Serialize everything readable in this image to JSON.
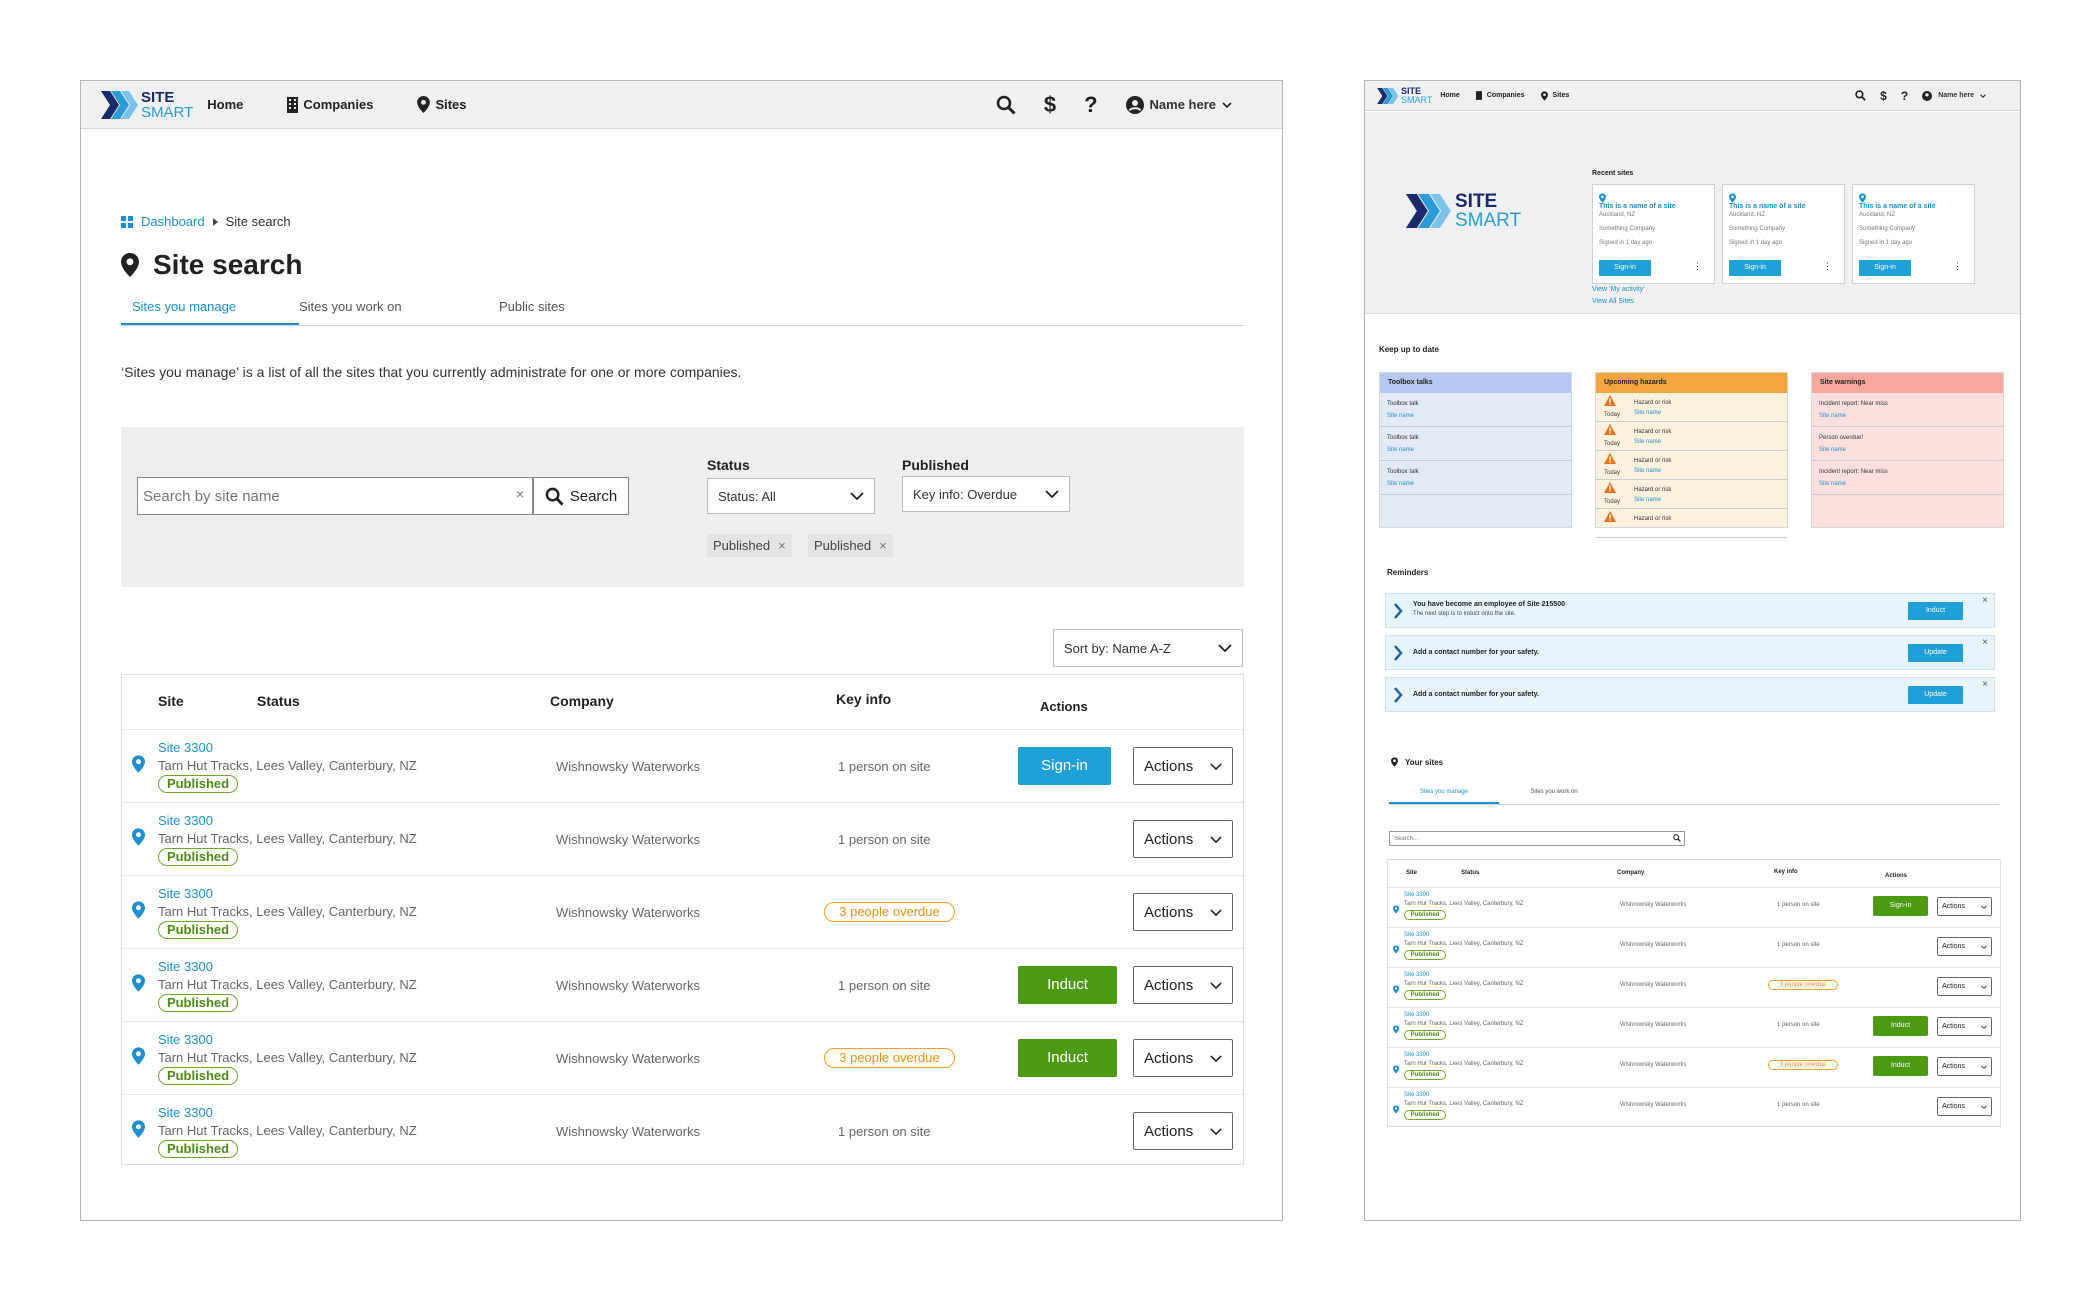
{
  "brand": {
    "line1": "SITE",
    "line2": "SMART"
  },
  "nav": {
    "home": "Home",
    "companies": "Companies",
    "sites": "Sites"
  },
  "header": {
    "user_name": "Name here"
  },
  "breadcrumb": {
    "dashboard": "Dashboard",
    "current": "Site search"
  },
  "page": {
    "title": "Site search",
    "tabs": [
      "Sites you manage",
      "Sites you work on",
      "Public sites"
    ],
    "description": "‘Sites you manage’ is a list of all the sites that you currently administrate for one or more companies."
  },
  "filters": {
    "search_placeholder": "Search by site name",
    "search_button": "Search",
    "status_label": "Status",
    "status_value": "Status: All",
    "published_label": "Published",
    "published_value": "Key info: Overdue",
    "chips": [
      "Published",
      "Published"
    ],
    "sort_value": "Sort by: Name A-Z"
  },
  "table": {
    "headers": {
      "site": "Site",
      "status": "Status",
      "company": "Company",
      "key_info": "Key info",
      "actions": "Actions"
    },
    "rows": [
      {
        "site": "Site 3300",
        "address": "Tarn Hut Tracks, Lees Valley, Canterbury, NZ",
        "status": "Published",
        "company": "Wishnowsky Waterworks",
        "key_info": "1 person on site",
        "overdue": false,
        "primary": "Sign-in",
        "primary_type": "blue",
        "actions": "Actions"
      },
      {
        "site": "Site 3300",
        "address": "Tarn Hut Tracks, Lees Valley, Canterbury, NZ",
        "status": "Published",
        "company": "Wishnowsky Waterworks",
        "key_info": "1 person on site",
        "overdue": false,
        "primary": "",
        "primary_type": "",
        "actions": "Actions"
      },
      {
        "site": "Site 3300",
        "address": "Tarn Hut Tracks, Lees Valley, Canterbury, NZ",
        "status": "Published",
        "company": "Wishnowsky Waterworks",
        "key_info": "3 people overdue",
        "overdue": true,
        "primary": "",
        "primary_type": "",
        "actions": "Actions"
      },
      {
        "site": "Site 3300",
        "address": "Tarn Hut Tracks, Lees Valley, Canterbury, NZ",
        "status": "Published",
        "company": "Wishnowsky Waterworks",
        "key_info": "1 person on site",
        "overdue": false,
        "primary": "Induct",
        "primary_type": "green",
        "actions": "Actions"
      },
      {
        "site": "Site 3300",
        "address": "Tarn Hut Tracks, Lees Valley, Canterbury, NZ",
        "status": "Published",
        "company": "Wishnowsky Waterworks",
        "key_info": "3 people overdue",
        "overdue": true,
        "primary": "Induct",
        "primary_type": "green",
        "actions": "Actions"
      },
      {
        "site": "Site 3300",
        "address": "Tarn Hut Tracks, Lees Valley, Canterbury, NZ",
        "status": "Published",
        "company": "Wishnowsky Waterworks",
        "key_info": "1 person on site",
        "overdue": false,
        "primary": "",
        "primary_type": "",
        "actions": "Actions"
      }
    ]
  },
  "dashboard": {
    "recent_sites_title": "Recent sites",
    "recent_sites": [
      {
        "name": "This is a name of a site",
        "location": "Auckland, NZ",
        "company": "Something Company",
        "signed": "Signed in 1 day ago",
        "button": "Sign-in"
      },
      {
        "name": "This is a name of a site",
        "location": "Auckland, NZ",
        "company": "Something Company",
        "signed": "Signed in 1 day ago",
        "button": "Sign-in"
      },
      {
        "name": "This is a name of a site",
        "location": "Auckland, NZ",
        "company": "Something Company",
        "signed": "Signed in 1 day ago",
        "button": "Sign-in"
      }
    ],
    "view_activity": "View ‘My activity’",
    "view_all": "View All Sites",
    "keep_up_title": "Keep up to date",
    "toolbox": {
      "title": "Toolbox talks",
      "items": [
        {
          "a": "Toolbox talk",
          "b": "Site name"
        },
        {
          "a": "Toolbox talk",
          "b": "Site name"
        },
        {
          "a": "Toolbox talk",
          "b": "Site name"
        }
      ]
    },
    "hazards": {
      "title": "Upcoming hazards",
      "items": [
        {
          "a": "Hazard or risk",
          "b": "Site name",
          "t": "Today"
        },
        {
          "a": "Hazard or risk",
          "b": "Site name",
          "t": "Today"
        },
        {
          "a": "Hazard or risk",
          "b": "Site name",
          "t": "Today"
        },
        {
          "a": "Hazard or risk",
          "b": "Site name",
          "t": "Today"
        },
        {
          "a": "Hazard or risk",
          "b": "",
          "t": ""
        }
      ]
    },
    "warnings": {
      "title": "Site warnings",
      "items": [
        {
          "a": "Incident report: Near miss",
          "b": "Site name"
        },
        {
          "a": "Person overdue!",
          "b": "Site name"
        },
        {
          "a": "Incident report: Near miss",
          "b": "Site name"
        }
      ]
    },
    "reminders_title": "Reminders",
    "reminders": [
      {
        "title": "You have become an employee of Site 215500",
        "sub": "The next step is to induct onto the site.",
        "button": "Induct"
      },
      {
        "title": "Add a contact number for your safety.",
        "sub": "",
        "button": "Update"
      },
      {
        "title": "Add a contact number for your safety.",
        "sub": "",
        "button": "Update"
      }
    ],
    "your_sites_title": "Your sites",
    "your_sites_tabs": [
      "Sites you manage",
      "Sites you work on"
    ],
    "search_placeholder": "Search..."
  },
  "colors": {
    "accent": "#1fa0d8",
    "brand_navy": "#1b2a6b",
    "green": "#4c9a12",
    "overdue": "#e8910c"
  }
}
